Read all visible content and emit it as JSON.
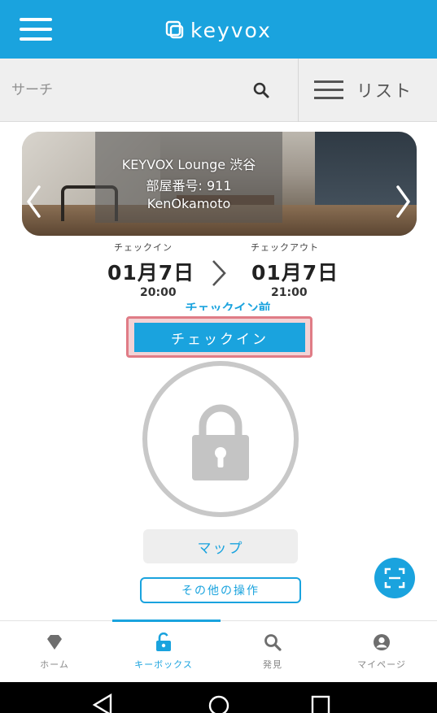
{
  "header": {
    "logo_text": "keyvox"
  },
  "search": {
    "placeholder": "サーチ",
    "list_label": "リスト"
  },
  "banner": {
    "location": "KEYVOX Lounge 渋谷",
    "room": "部屋番号: 911",
    "user": "KenOkamoto"
  },
  "booking": {
    "checkin_caption": "チェックイン",
    "checkin_date": "01月7日",
    "checkin_time": "20:00",
    "checkout_caption": "チェックアウト",
    "checkout_date": "01月7日",
    "checkout_time": "21:00",
    "status": "チェックイン前"
  },
  "actions": {
    "checkin_label": "チェックイン",
    "map_label": "マップ",
    "other_label": "その他の操作"
  },
  "tabs": [
    {
      "label": "ホーム",
      "icon": "diamond-icon",
      "active": false
    },
    {
      "label": "キーボックス",
      "icon": "unlocked-padlock-icon",
      "active": true
    },
    {
      "label": "発見",
      "icon": "search-icon",
      "active": false
    },
    {
      "label": "マイページ",
      "icon": "person-circle-icon",
      "active": false
    }
  ],
  "colors": {
    "accent": "#1aa3de",
    "highlight_frame": "#e07c86",
    "lock_gray": "#c8c8c8"
  }
}
